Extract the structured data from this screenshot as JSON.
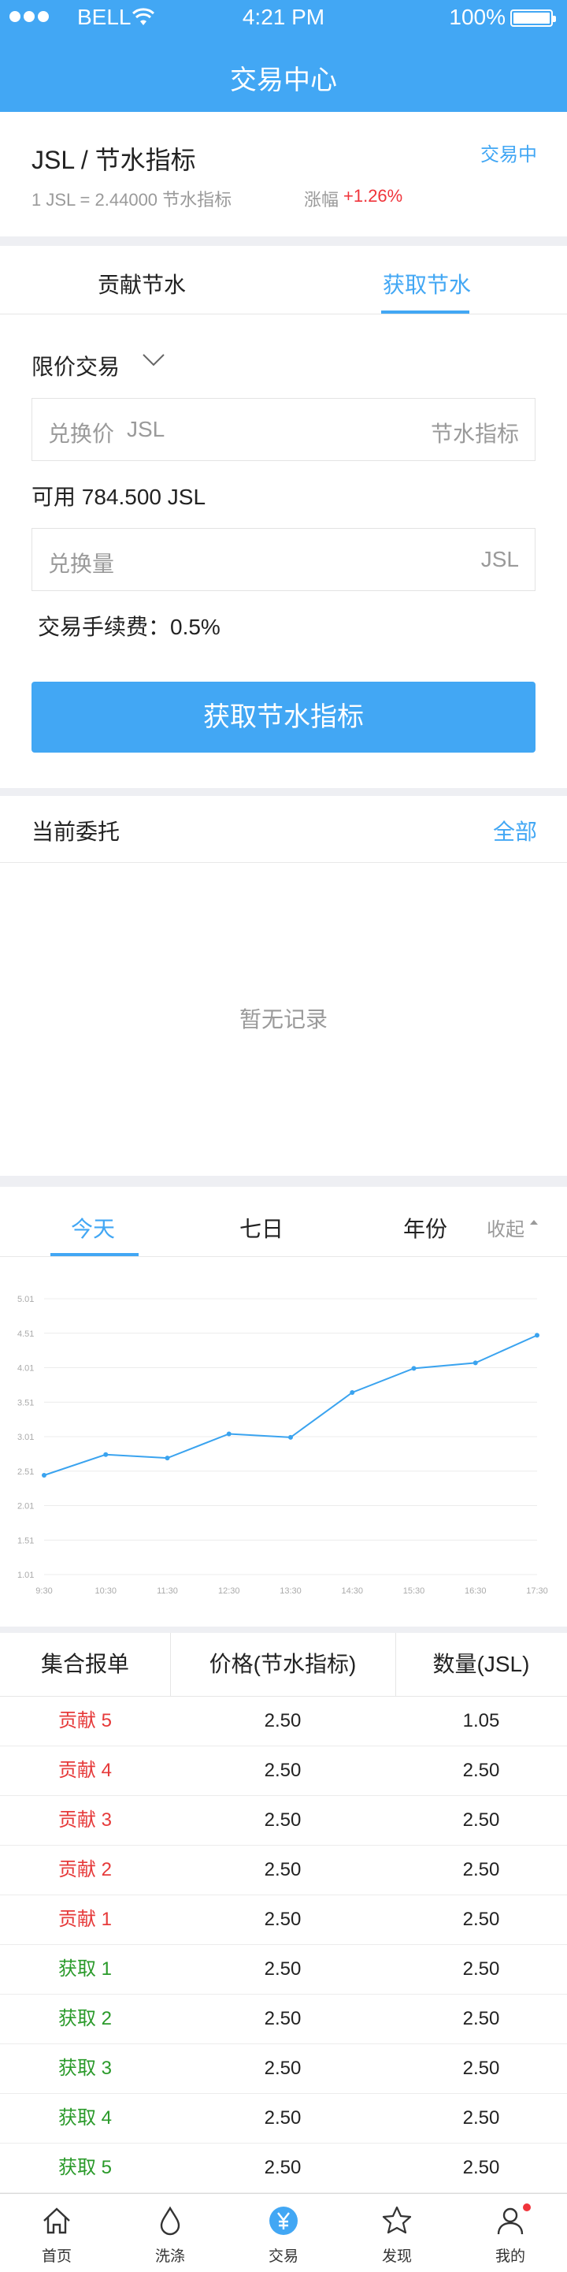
{
  "status_bar": {
    "carrier": "BELL",
    "time": "4:21 PM",
    "battery": "100%"
  },
  "nav": {
    "title": "交易中心"
  },
  "pair": {
    "name": "JSL / 节水指标",
    "link": "交易中",
    "rate": "1 JSL = 2.44000 节水指标",
    "change_label": "涨幅",
    "change": "+1.26%"
  },
  "trade": {
    "tabs": [
      "贡献节水",
      "获取节水"
    ],
    "active_tab": 1,
    "order_type": "限价交易",
    "price_field": {
      "label": "兑换价",
      "currency": "JSL",
      "unit": "节水指标"
    },
    "available": "可用 784.500 JSL",
    "qty_field": {
      "placeholder": "兑换量",
      "unit": "JSL"
    },
    "fee": "交易手续费：0.5%",
    "submit": "获取节水指标"
  },
  "orders": {
    "title": "当前委托",
    "all": "全部",
    "empty": "暂无记录"
  },
  "chart_tabs": {
    "items": [
      "今天",
      "七日",
      "年份"
    ],
    "active": 0,
    "collapse": "收起"
  },
  "chart_data": {
    "type": "line",
    "x": [
      "9:30",
      "10:30",
      "11:30",
      "12:30",
      "13:30",
      "14:30",
      "15:30",
      "16:30",
      "17:30"
    ],
    "series": [
      {
        "values": [
          2.45,
          2.75,
          2.7,
          3.05,
          3.0,
          3.65,
          4.0,
          4.08,
          4.48
        ]
      }
    ],
    "y_ticks": [
      "1.01",
      "1.51",
      "2.01",
      "2.51",
      "3.01",
      "3.51",
      "4.01",
      "4.51",
      "5.01"
    ],
    "ylim": [
      1.01,
      5.01
    ],
    "grid": true,
    "line_color": "#3aa3ef"
  },
  "book": {
    "headers": [
      "集合报单",
      "价格(节水指标)",
      "数量(JSL)"
    ],
    "rows": [
      {
        "side": "贡献 5",
        "type": "sell",
        "price": "2.50",
        "qty": "1.05"
      },
      {
        "side": "贡献 4",
        "type": "sell",
        "price": "2.50",
        "qty": "2.50"
      },
      {
        "side": "贡献 3",
        "type": "sell",
        "price": "2.50",
        "qty": "2.50"
      },
      {
        "side": "贡献 2",
        "type": "sell",
        "price": "2.50",
        "qty": "2.50"
      },
      {
        "side": "贡献 1",
        "type": "sell",
        "price": "2.50",
        "qty": "2.50"
      },
      {
        "side": "获取 1",
        "type": "buy",
        "price": "2.50",
        "qty": "2.50"
      },
      {
        "side": "获取 2",
        "type": "buy",
        "price": "2.50",
        "qty": "2.50"
      },
      {
        "side": "获取 3",
        "type": "buy",
        "price": "2.50",
        "qty": "2.50"
      },
      {
        "side": "获取 4",
        "type": "buy",
        "price": "2.50",
        "qty": "2.50"
      },
      {
        "side": "获取 5",
        "type": "buy",
        "price": "2.50",
        "qty": "2.50"
      }
    ]
  },
  "tabbar": {
    "items": [
      {
        "label": "首页",
        "icon": "home-icon"
      },
      {
        "label": "洗涤",
        "icon": "drop-icon"
      },
      {
        "label": "交易",
        "icon": "yen-icon"
      },
      {
        "label": "发现",
        "icon": "star-icon"
      },
      {
        "label": "我的",
        "icon": "user-icon"
      }
    ],
    "active": 2
  },
  "colors": {
    "accent": "#42a7f4",
    "up": "#f0343b",
    "sell": "#e63a3a",
    "buy": "#2a9a2a"
  }
}
